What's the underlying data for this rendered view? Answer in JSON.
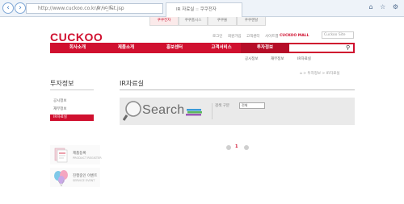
{
  "browser": {
    "address": "http://www.cuckoo.co.kr/ir/ir_list.jsp",
    "address_tools": "ρ - ⌂ C",
    "tab_title": "IR 자료실 :: 쿠쿠전자",
    "controls": "⌂ ☆ ⚙"
  },
  "utility_tabs": [
    "쿠쿠전자",
    "쿠쿠홈시스",
    "쿠쿠몰",
    "쿠쿠렌탈"
  ],
  "header": {
    "logo": "CUCKOO",
    "links": [
      "로그인",
      "회원가입",
      "고객센터",
      "사이트맵"
    ],
    "highlight_link": "CUCKOO MALL",
    "lang_select": "Cuckoo Site"
  },
  "gnb": {
    "items": [
      "회사소개",
      "제품소개",
      "홍보센터",
      "고객서비스",
      "투자정보"
    ],
    "active_index": 4
  },
  "subnav": [
    "공시정보",
    "재무정보",
    "IR자료실"
  ],
  "sidebar": {
    "title": "투자정보",
    "items": [
      "공시정보",
      "재무정보",
      "IR자료실"
    ],
    "active_item": "IR자료실",
    "banners": [
      {
        "title": "제품등록",
        "subtitle": "PRODUCT REGISTER"
      },
      {
        "title": "진행중인 이벤트",
        "subtitle": "SERVICE EVENT"
      }
    ]
  },
  "main": {
    "breadcrumb": "⌂ > 투자정보 > IR자료실",
    "title": "IR자료실",
    "search_word": "Search",
    "search_label": "검색 구분",
    "search_select": "전체"
  },
  "pagination": {
    "current": "1"
  },
  "colors": {
    "brand_red": "#d0102f",
    "search_bg": "#eaeaea"
  }
}
